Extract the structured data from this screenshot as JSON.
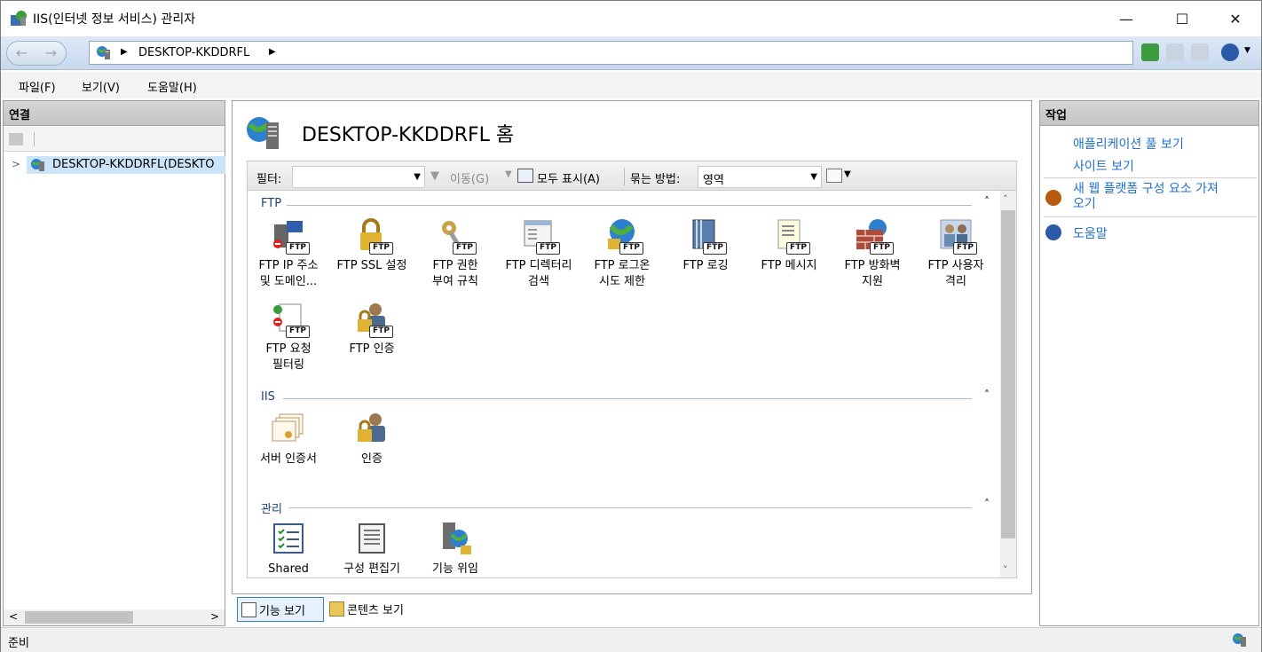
{
  "window": {
    "title": "IIS(인터넷 정보 서비스) 관리자",
    "minimize": "—",
    "maximize": "☐",
    "close": "✕"
  },
  "address": {
    "back": "←",
    "forward": "→",
    "crumb": "DESKTOP-KKDDRFL",
    "sep": "▶"
  },
  "menu": {
    "file": "파일(F)",
    "view": "보기(V)",
    "help": "도움말(H)"
  },
  "connections": {
    "header": "연결",
    "tree_expand": ">",
    "server_node": "DESKTOP-KKDDRFL(DESKTO",
    "scroll_left": "<",
    "scroll_right": ">"
  },
  "center": {
    "title": "DESKTOP-KKDDRFL 홈",
    "filter_label": "필터:",
    "go_label": "이동(G)",
    "show_all_label": "모두 표시(A)",
    "group_by_label": "묶는 방법:",
    "group_by_value": "영역"
  },
  "groups": [
    {
      "name": "FTP",
      "caret": "˄"
    },
    {
      "name": "IIS",
      "caret": "˄"
    },
    {
      "name": "관리",
      "caret": "˄"
    }
  ],
  "features": {
    "ftp": [
      {
        "line1": "FTP IP 주소",
        "line2": "및 도메인..."
      },
      {
        "line1": "FTP SSL 설정",
        "line2": ""
      },
      {
        "line1": "FTP 권한",
        "line2": "부여 규칙"
      },
      {
        "line1": "FTP 디렉터리",
        "line2": "검색"
      },
      {
        "line1": "FTP 로그온",
        "line2": "시도 제한"
      },
      {
        "line1": "FTP 로깅",
        "line2": ""
      },
      {
        "line1": "FTP 메시지",
        "line2": ""
      },
      {
        "line1": "FTP 방화벽",
        "line2": "지원"
      },
      {
        "line1": "FTP 사용자",
        "line2": "격리"
      },
      {
        "line1": "FTP 요청",
        "line2": "필터링"
      },
      {
        "line1": "FTP 인증",
        "line2": ""
      }
    ],
    "iis": [
      {
        "line1": "서버 인증서",
        "line2": ""
      },
      {
        "line1": "인증",
        "line2": ""
      }
    ],
    "management": [
      {
        "line1": "Shared",
        "line2": ""
      },
      {
        "line1": "구성 편집기",
        "line2": ""
      },
      {
        "line1": "기능 위임",
        "line2": ""
      }
    ],
    "badge": "FTP"
  },
  "view_tabs": {
    "features": "기능 보기",
    "content": "콘텐츠 보기"
  },
  "actions": {
    "header": "작업",
    "view_app_pools": "애플리케이션 풀 보기",
    "view_sites": "사이트 보기",
    "get_platform_1": "새 웹 플랫폼 구성 요소 가져",
    "get_platform_2": "오기",
    "help": "도움말"
  },
  "status": {
    "text": "준비"
  },
  "colors": {
    "link": "#1f6fcf",
    "selection": "#cce4f7",
    "group_line": "#a9bddb"
  }
}
